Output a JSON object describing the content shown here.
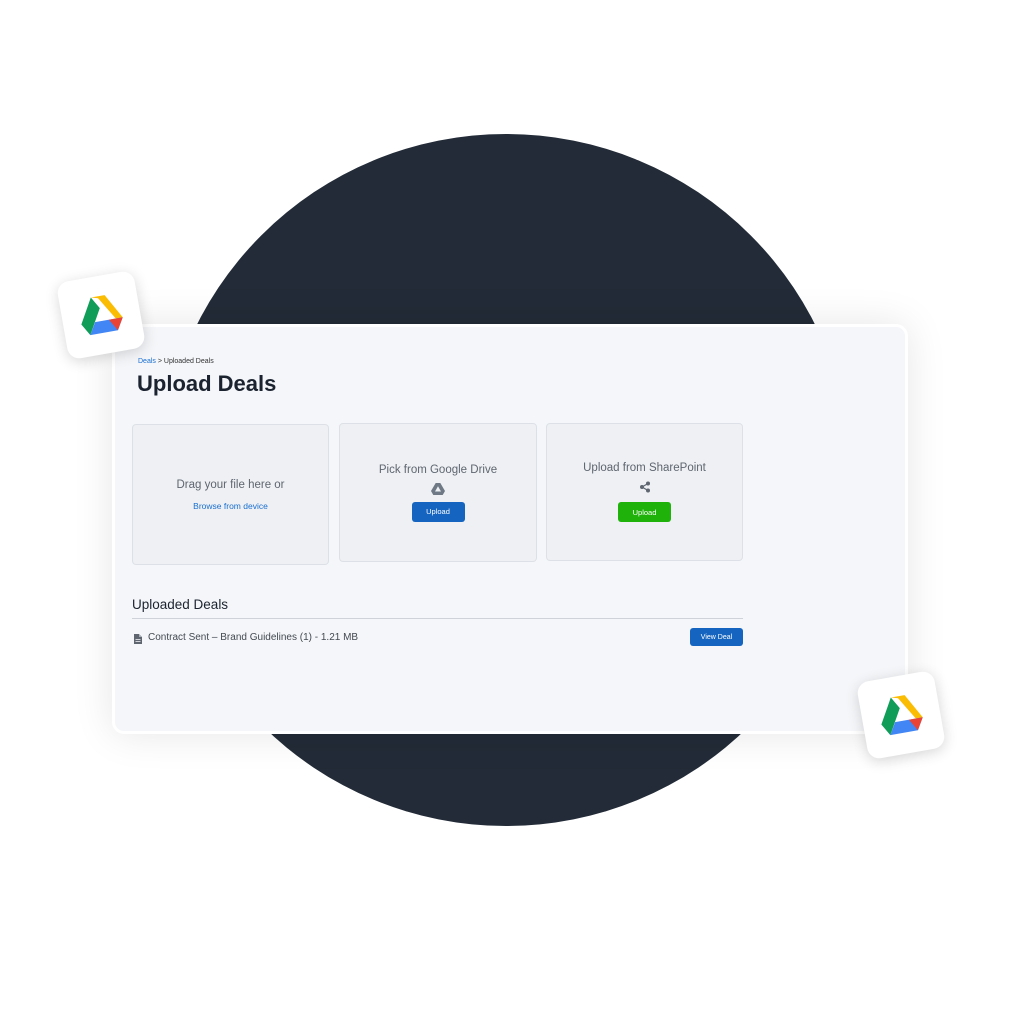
{
  "breadcrumb": {
    "root": "Deals",
    "separator": " > ",
    "current": "Uploaded Deals"
  },
  "page": {
    "title": "Upload Deals"
  },
  "upload_options": {
    "drag_drop": {
      "text": "Drag your file here or",
      "link": "Browse from device"
    },
    "google_drive": {
      "text": "Pick from Google Drive",
      "icon": "google-drive-icon",
      "button_label": "Upload"
    },
    "sharepoint": {
      "text": "Upload from SharePoint",
      "icon": "share-icon",
      "button_label": "Upload"
    }
  },
  "uploaded": {
    "title": "Uploaded Deals",
    "items": [
      {
        "name": "Contract Sent – Brand Guidelines (1) - 1.21 MB",
        "icon": "file-icon",
        "action_label": "View Deal"
      }
    ]
  },
  "decorations": {
    "floating_tiles": [
      "google-drive-logo",
      "google-drive-logo"
    ]
  },
  "colors": {
    "primary_blue": "#1565c0",
    "success_green": "#1fb20a",
    "link_blue": "#1a6fd1",
    "background_circle": "#222b37"
  }
}
